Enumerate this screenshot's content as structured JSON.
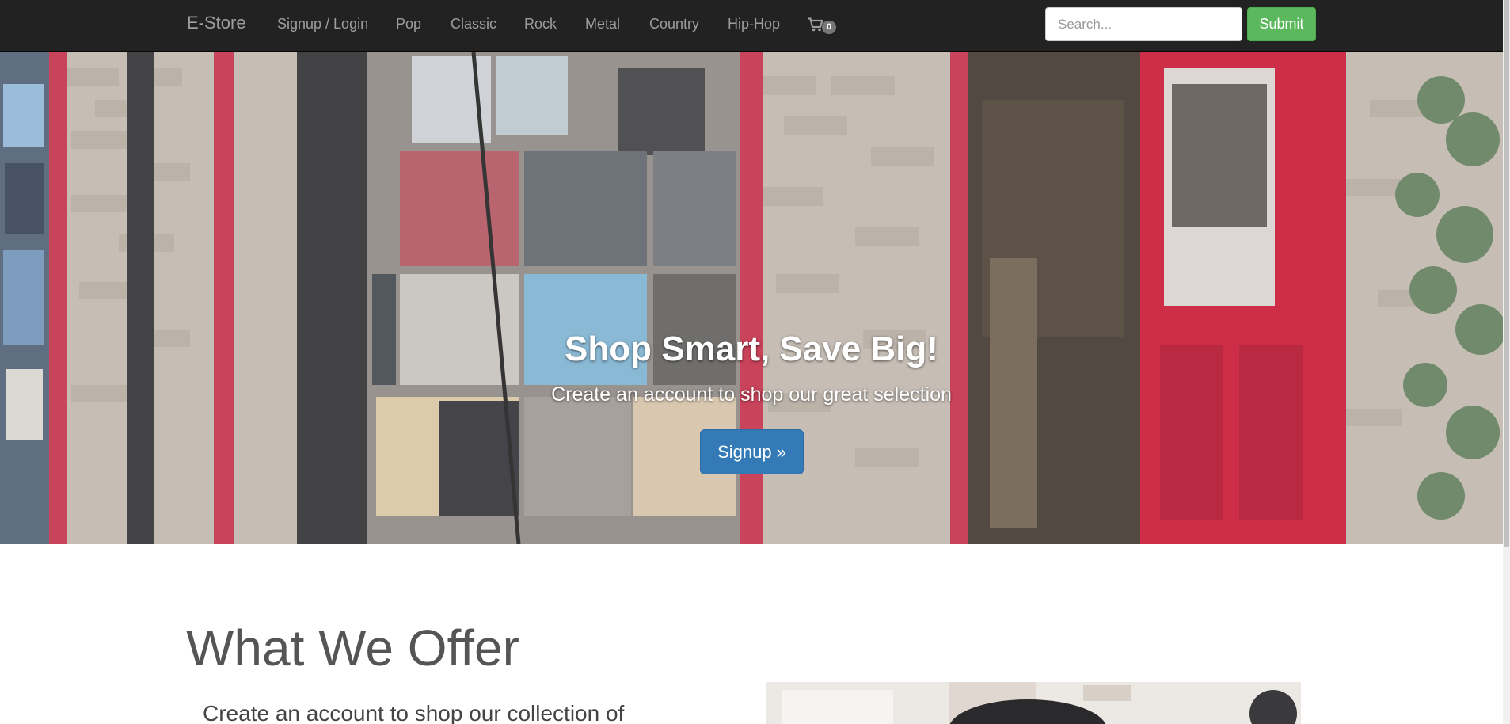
{
  "navbar": {
    "brand": "E-Store",
    "links": [
      {
        "label": "Signup / Login"
      },
      {
        "label": "Pop"
      },
      {
        "label": "Classic"
      },
      {
        "label": "Rock"
      },
      {
        "label": "Metal"
      },
      {
        "label": "Country"
      },
      {
        "label": "Hip-Hop"
      }
    ],
    "cart": {
      "icon": "shopping-cart-icon",
      "count": "0"
    },
    "search": {
      "placeholder": "Search...",
      "value": ""
    },
    "submit_label": "Submit"
  },
  "hero": {
    "title": "Shop Smart, Save Big!",
    "subtitle": "Create an account to shop our great selection",
    "cta_label": "Signup »",
    "background": "record-store-storefront-photo"
  },
  "offer": {
    "heading": "What We Offer",
    "text": "Create an account to shop our collection of",
    "image": "vinyl-record-photo"
  },
  "colors": {
    "navbar_bg": "#222222",
    "nav_text": "#9d9d9d",
    "submit_green": "#5cb85c",
    "signup_blue": "#337ab7",
    "door_red": "#c8102e"
  }
}
